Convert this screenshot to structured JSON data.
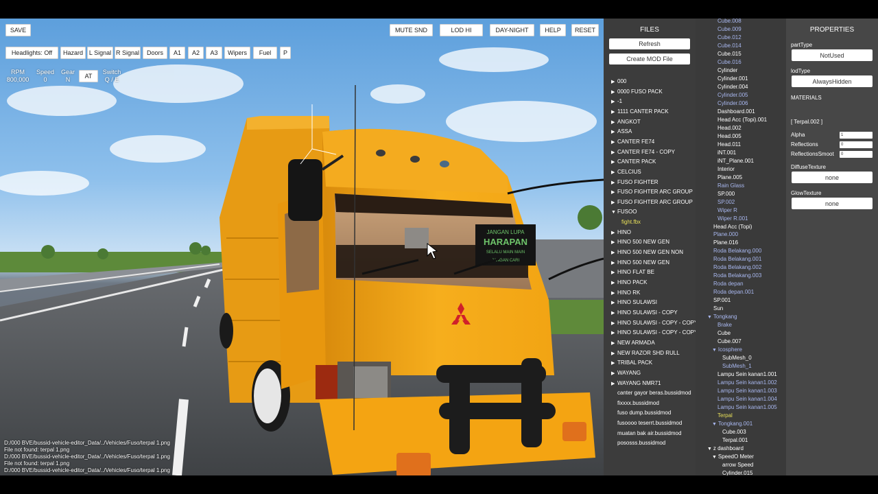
{
  "toolbar": {
    "save": "SAVE",
    "mute": "MUTE SND",
    "lod": "LOD HI",
    "daynight": "DAY-NIGHT",
    "help": "HELP",
    "reset": "RESET"
  },
  "controls": {
    "headlights": "Headlights: Off",
    "hazard": "Hazard",
    "lsignal": "L Signal",
    "rsignal": "R Signal",
    "doors": "Doors",
    "a1": "A1",
    "a2": "A2",
    "a3": "A3",
    "wipers": "Wipers",
    "fuel": "Fuel",
    "p": "P"
  },
  "readouts": {
    "rpm_label": "RPM",
    "rpm_value": "800,000",
    "speed_label": "Speed",
    "speed_value": "0",
    "gear_label": "Gear",
    "gear_value": "N",
    "at": "AT",
    "switch_label": "Switch",
    "switch_value": "Q / E"
  },
  "console": [
    "D:/000 BVE/bussid-vehicle-editor_Data/../Vehicles/Fuso/terpal 1.png",
    "File not found: terpal 1.png",
    "D:/000 BVE/bussid-vehicle-editor_Data/../Vehicles/Fuso/terpal 1.png",
    "File not found: terpal 1.png",
    "D:/000 BVE/bussid-vehicle-editor_Data/../Vehicles/Fuso/terpal 1.png"
  ],
  "files": {
    "title": "FILES",
    "refresh": "Refresh",
    "create_mod": "Create MOD File",
    "items": [
      {
        "label": "000",
        "arrow": "▶",
        "sel": false
      },
      {
        "label": "0000 FUSO PACK",
        "arrow": "▶",
        "sel": false
      },
      {
        "label": "-1",
        "arrow": "▶",
        "sel": false
      },
      {
        "label": "1111 CANTER PACK",
        "arrow": "▶",
        "sel": false
      },
      {
        "label": "ANGKOT",
        "arrow": "▶",
        "sel": false
      },
      {
        "label": "ASSA",
        "arrow": "▶",
        "sel": false
      },
      {
        "label": "CANTER FE74",
        "arrow": "▶",
        "sel": false
      },
      {
        "label": "CANTER FE74 - COPY",
        "arrow": "▶",
        "sel": false
      },
      {
        "label": "CANTER PACK",
        "arrow": "▶",
        "sel": false
      },
      {
        "label": "CELCIUS",
        "arrow": "▶",
        "sel": false
      },
      {
        "label": "FUSO FIGHTER",
        "arrow": "▶",
        "sel": false
      },
      {
        "label": "FUSO FIGHTER ARC GROUP",
        "arrow": "▶",
        "sel": false
      },
      {
        "label": "FUSO FIGHTER ARC GROUP",
        "arrow": "▶",
        "sel": false
      },
      {
        "label": "FUSOO",
        "arrow": "▼",
        "sel": false
      },
      {
        "label": "fight.fbx",
        "arrow": "",
        "sel": true
      },
      {
        "label": "HINO",
        "arrow": "▶",
        "sel": false
      },
      {
        "label": "HINO 500 NEW GEN",
        "arrow": "▶",
        "sel": false
      },
      {
        "label": "HINO 500 NEW GEN NON",
        "arrow": "▶",
        "sel": false
      },
      {
        "label": "HINO 500 NEW GEN",
        "arrow": "▶",
        "sel": false
      },
      {
        "label": "HINO FLAT BE",
        "arrow": "▶",
        "sel": false
      },
      {
        "label": "HINO PACK",
        "arrow": "▶",
        "sel": false
      },
      {
        "label": "HINO RK",
        "arrow": "▶",
        "sel": false
      },
      {
        "label": "HINO SULAWSI",
        "arrow": "▶",
        "sel": false
      },
      {
        "label": "HINO SULAWSI - COPY",
        "arrow": "▶",
        "sel": false
      },
      {
        "label": "HINO SULAWSI - COPY - COPY",
        "arrow": "▶",
        "sel": false
      },
      {
        "label": "HINO SULAWSI - COPY - COPY",
        "arrow": "▶",
        "sel": false
      },
      {
        "label": "NEW ARMADA",
        "arrow": "▶",
        "sel": false
      },
      {
        "label": "NEW RAZOR SHD RULL",
        "arrow": "▶",
        "sel": false
      },
      {
        "label": "TRIBAL PACK",
        "arrow": "▶",
        "sel": false
      },
      {
        "label": "WAYANG",
        "arrow": "▶",
        "sel": false
      },
      {
        "label": "WAYANG NMR71",
        "arrow": "▶",
        "sel": false
      },
      {
        "label": "canter gayor beras.bussidmod",
        "arrow": "",
        "sel": false
      },
      {
        "label": "fixxxx.bussidmod",
        "arrow": "",
        "sel": false
      },
      {
        "label": "fuso dump.bussidmod",
        "arrow": "",
        "sel": false
      },
      {
        "label": "fusoooo teserrt.bussidmod",
        "arrow": "",
        "sel": false
      },
      {
        "label": "muatan bak air.bussidmod",
        "arrow": "",
        "sel": false
      },
      {
        "label": "pososss.bussidmod",
        "arrow": "",
        "sel": false
      }
    ]
  },
  "hierarchy": [
    {
      "label": "Cube.008",
      "indent": 32,
      "style": "dim",
      "arrow": ""
    },
    {
      "label": "Cube.009",
      "indent": 32,
      "style": "dim",
      "arrow": ""
    },
    {
      "label": "Cube.012",
      "indent": 32,
      "style": "dim",
      "arrow": ""
    },
    {
      "label": "Cube.014",
      "indent": 32,
      "style": "dim",
      "arrow": ""
    },
    {
      "label": "Cube.015",
      "indent": 32,
      "style": "",
      "arrow": ""
    },
    {
      "label": "Cube.016",
      "indent": 32,
      "style": "dim",
      "arrow": ""
    },
    {
      "label": "Cylinder",
      "indent": 32,
      "style": "",
      "arrow": ""
    },
    {
      "label": "Cylinder.001",
      "indent": 32,
      "style": "",
      "arrow": ""
    },
    {
      "label": "Cylinder.004",
      "indent": 32,
      "style": "",
      "arrow": ""
    },
    {
      "label": "Cylinder.005",
      "indent": 32,
      "style": "dim",
      "arrow": ""
    },
    {
      "label": "Cylinder.006",
      "indent": 32,
      "style": "dim",
      "arrow": ""
    },
    {
      "label": "Dashboard.001",
      "indent": 32,
      "style": "",
      "arrow": ""
    },
    {
      "label": "Head Acc (Topi).001",
      "indent": 32,
      "style": "",
      "arrow": ""
    },
    {
      "label": "Head.002",
      "indent": 32,
      "style": "",
      "arrow": ""
    },
    {
      "label": "Head.005",
      "indent": 32,
      "style": "",
      "arrow": ""
    },
    {
      "label": "Head.011",
      "indent": 32,
      "style": "",
      "arrow": ""
    },
    {
      "label": "iNT.001",
      "indent": 32,
      "style": "",
      "arrow": ""
    },
    {
      "label": "iNT_Plane.001",
      "indent": 32,
      "style": "",
      "arrow": ""
    },
    {
      "label": "Interior",
      "indent": 32,
      "style": "",
      "arrow": ""
    },
    {
      "label": "Plane.005",
      "indent": 32,
      "style": "",
      "arrow": ""
    },
    {
      "label": "Rain Glass",
      "indent": 32,
      "style": "dim",
      "arrow": ""
    },
    {
      "label": "SP.000",
      "indent": 32,
      "style": "",
      "arrow": ""
    },
    {
      "label": "SP.002",
      "indent": 32,
      "style": "dim",
      "arrow": ""
    },
    {
      "label": "Wiper R",
      "indent": 32,
      "style": "dim",
      "arrow": ""
    },
    {
      "label": "Wiper R.001",
      "indent": 32,
      "style": "dim",
      "arrow": ""
    },
    {
      "label": "Head Acc (Topi)",
      "indent": 26,
      "style": "",
      "arrow": ""
    },
    {
      "label": "Plane.000",
      "indent": 26,
      "style": "dim",
      "arrow": ""
    },
    {
      "label": "Plane.016",
      "indent": 26,
      "style": "",
      "arrow": ""
    },
    {
      "label": "Roda Belakang.000",
      "indent": 26,
      "style": "dim",
      "arrow": ""
    },
    {
      "label": "Roda Belakang.001",
      "indent": 26,
      "style": "dim",
      "arrow": ""
    },
    {
      "label": "Roda Belakang.002",
      "indent": 26,
      "style": "dim",
      "arrow": ""
    },
    {
      "label": "Roda Belakang.003",
      "indent": 26,
      "style": "dim",
      "arrow": ""
    },
    {
      "label": "Roda depan",
      "indent": 26,
      "style": "dim",
      "arrow": ""
    },
    {
      "label": "Roda depan.001",
      "indent": 26,
      "style": "dim",
      "arrow": ""
    },
    {
      "label": "SP.001",
      "indent": 26,
      "style": "",
      "arrow": ""
    },
    {
      "label": "Sun",
      "indent": 26,
      "style": "",
      "arrow": ""
    },
    {
      "label": "Tongkang",
      "indent": 17,
      "style": "dim",
      "arrow": "▼ "
    },
    {
      "label": "Brake",
      "indent": 32,
      "style": "dim",
      "arrow": ""
    },
    {
      "label": "Cube",
      "indent": 32,
      "style": "",
      "arrow": ""
    },
    {
      "label": "Cube.007",
      "indent": 32,
      "style": "",
      "arrow": ""
    },
    {
      "label": "Icosphere",
      "indent": 24,
      "style": "dim",
      "arrow": "▼ "
    },
    {
      "label": "SubMesh_0",
      "indent": 39,
      "style": "",
      "arrow": ""
    },
    {
      "label": "SubMesh_1",
      "indent": 39,
      "style": "dim",
      "arrow": ""
    },
    {
      "label": "Lampu Sein kanan1.001",
      "indent": 32,
      "style": "",
      "arrow": ""
    },
    {
      "label": "Lampu Sein kanan1.002",
      "indent": 32,
      "style": "dim",
      "arrow": ""
    },
    {
      "label": "Lampu Sein kanan1.003",
      "indent": 32,
      "style": "dim",
      "arrow": ""
    },
    {
      "label": "Lampu Sein kanan1.004",
      "indent": 32,
      "style": "dim",
      "arrow": ""
    },
    {
      "label": "Lampu Sein kanan1.005",
      "indent": 32,
      "style": "dim",
      "arrow": ""
    },
    {
      "label": "Terpal",
      "indent": 32,
      "style": "sel",
      "arrow": ""
    },
    {
      "label": "Tongkang.001",
      "indent": 24,
      "style": "dim",
      "arrow": "▼ "
    },
    {
      "label": "Cube.003",
      "indent": 39,
      "style": "",
      "arrow": ""
    },
    {
      "label": "Terpal.001",
      "indent": 39,
      "style": "",
      "arrow": ""
    },
    {
      "label": "z dashboard",
      "indent": 17,
      "style": "",
      "arrow": "▼ "
    },
    {
      "label": "SpeedO Meter",
      "indent": 24,
      "style": "",
      "arrow": "▼ "
    },
    {
      "label": "arrow Speed",
      "indent": 39,
      "style": "",
      "arrow": ""
    },
    {
      "label": "Cylinder.015",
      "indent": 39,
      "style": "",
      "arrow": ""
    }
  ],
  "properties": {
    "title": "PROPERTIES",
    "part_type_label": "partType",
    "part_type_value": "NotUsed",
    "lod_type_label": "lodType",
    "lod_type_value": "AlwaysHidden",
    "materials_label": "MATERIALS",
    "material_name": "[ Terpal.002 ]",
    "alpha_label": "Alpha",
    "alpha_value": "1",
    "reflections_label": "Reflections",
    "reflections_value": "0",
    "reflections_smooth_label": "ReflectionsSmoot",
    "reflections_smooth_value": "0",
    "diffuse_label": "DiffuseTexture",
    "diffuse_value": "none",
    "glow_label": "GlowTexture",
    "glow_value": "none"
  },
  "scene": {
    "truck_color": "#f2a413",
    "logo_color": "#d0202a",
    "windshield_text": [
      "JANGAN LUPA",
      "HARAPAN",
      "SELALU MAIN MAIN",
      "JANGAN CARI"
    ]
  }
}
